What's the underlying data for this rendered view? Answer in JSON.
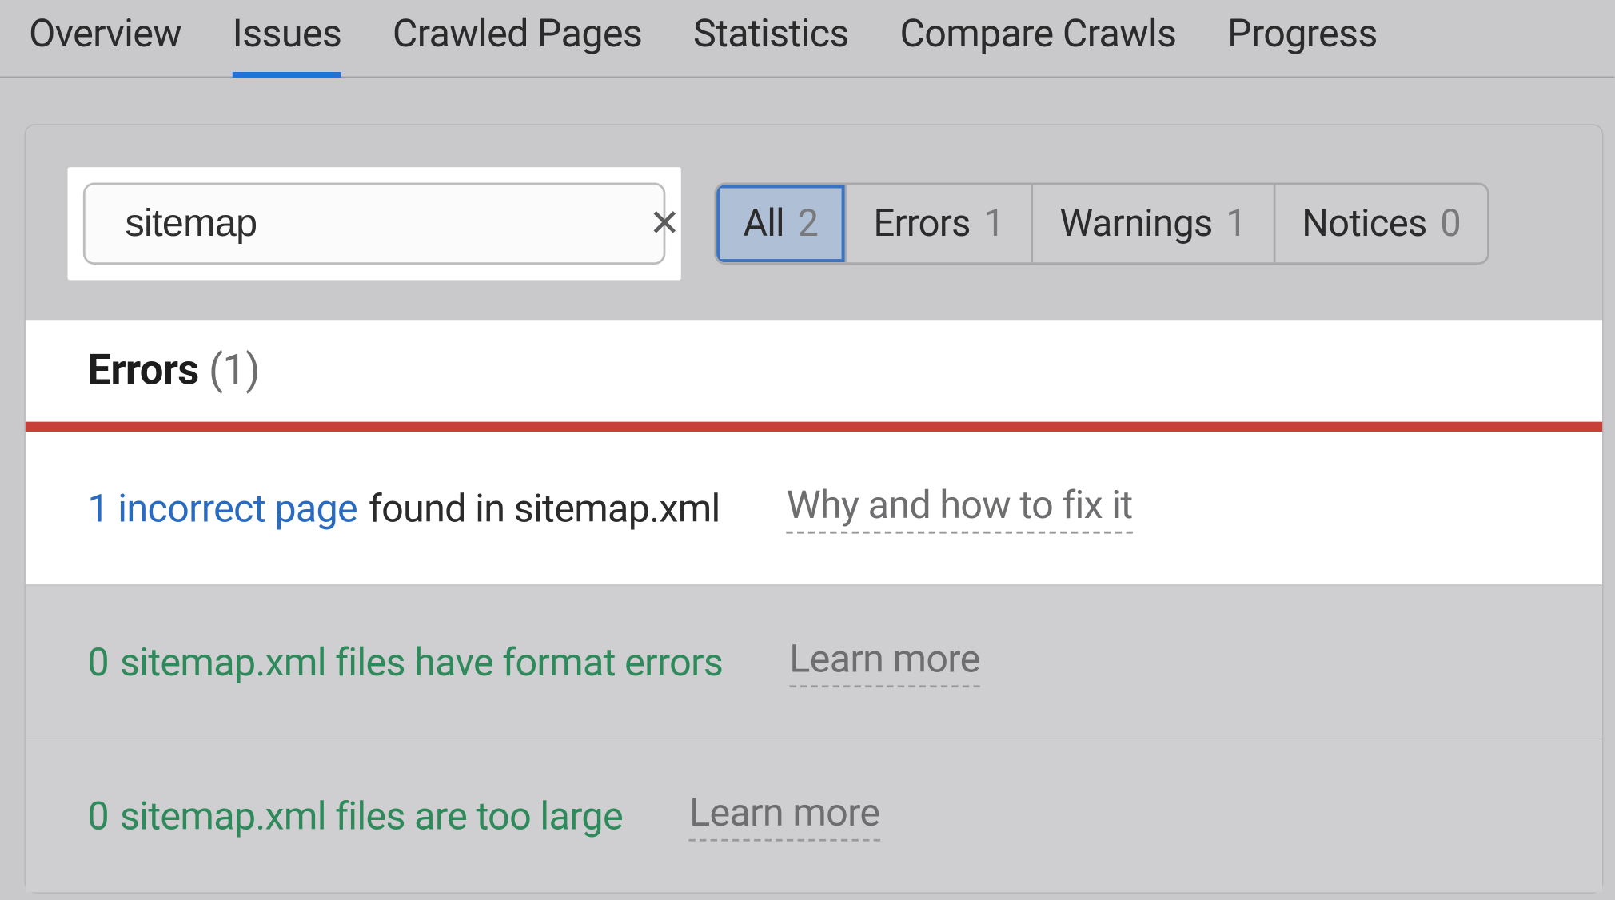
{
  "tabs": {
    "overview": "Overview",
    "issues": "Issues",
    "crawled": "Crawled Pages",
    "statistics": "Statistics",
    "compare": "Compare Crawls",
    "progress": "Progress",
    "active": "issues"
  },
  "search": {
    "value": "sitemap"
  },
  "filters": {
    "all_label": "All",
    "all_count": "2",
    "errors_label": "Errors",
    "errors_count": "1",
    "warnings_label": "Warnings",
    "warnings_count": "1",
    "notices_label": "Notices",
    "notices_count": "0"
  },
  "section": {
    "title": "Errors",
    "count": "(1)"
  },
  "rows": [
    {
      "prefix": "1 incorrect page",
      "rest": "found in sitemap.xml",
      "link": "Why and how to fix it",
      "active": true
    },
    {
      "prefix": "0",
      "rest": "sitemap.xml files have format errors",
      "link": "Learn more",
      "active": false
    },
    {
      "prefix": "0",
      "rest": "sitemap.xml files are too large",
      "link": "Learn more",
      "active": false
    }
  ]
}
